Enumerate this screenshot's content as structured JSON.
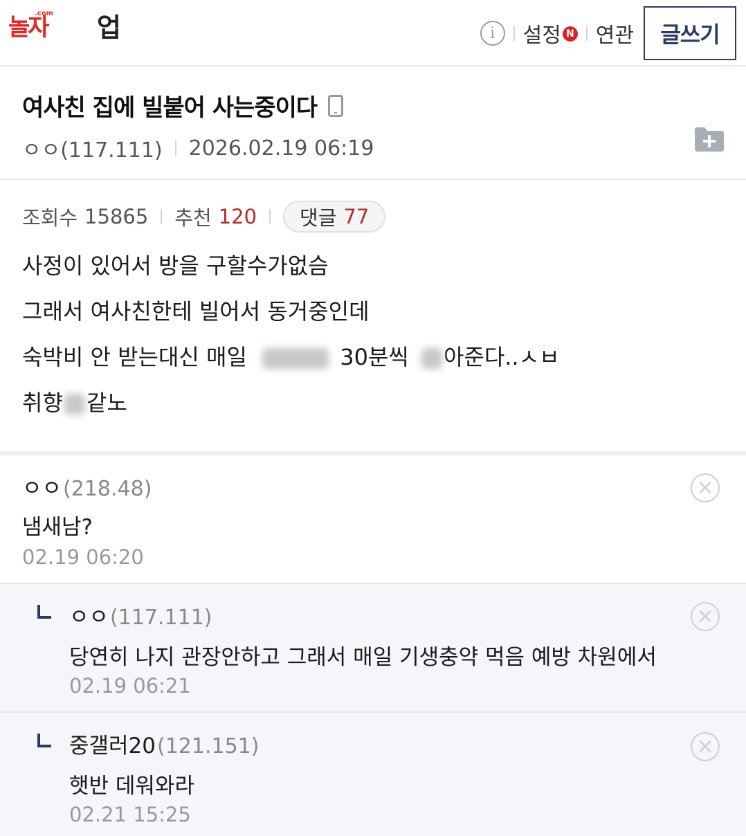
{
  "header": {
    "logo_brand": "놀자",
    "logo_brand_small": ".com",
    "logo_suffix": "업",
    "settings_label": "설정",
    "settings_badge": "N",
    "related_label": "연관",
    "write_label": "글쓰기"
  },
  "post": {
    "title": "여사친 집에 빌붙어 사는중이다",
    "author": "ㅇㅇ(117.111)",
    "datetime": "2026.02.19 06:19",
    "views_label": "조회수",
    "views": "15865",
    "recommend_label": "추천",
    "recommend": "120",
    "comments_label": "댓글",
    "comments": "77",
    "body": {
      "line1": "사정이 있어서 방을 구할수가없슴",
      "line2": "그래서 여사친한테 빌어서 동거중인데",
      "line3a": "숙박비 안 받는대신 매일",
      "line3b": "30분씩",
      "line3c": "아준다..ㅅㅂ",
      "line4a": "취향",
      "line4b": "같노"
    }
  },
  "comments": [
    {
      "nick": "ㅇㅇ",
      "ip": "(218.48)",
      "text": "냄새남?",
      "date": "02.19 06:20"
    },
    {
      "nick": "ㅇㅇ",
      "ip": "(117.111)",
      "text": "당연히 나지 관장안하고 그래서 매일 기생충약 먹음 예방 차원에서",
      "date": "02.19 06:21"
    },
    {
      "nick": "중갤러20",
      "ip": "(121.151)",
      "text": "햇반 데워와라",
      "date": "02.21 15:25"
    }
  ],
  "icons": {
    "info": "info-icon",
    "mobile": "mobile-icon",
    "folder_add": "folder-add-icon",
    "delete": "delete-icon",
    "reply": "reply-arrow-icon"
  },
  "colors": {
    "accent_navy": "#2b3a66",
    "count_red": "#b52b2b",
    "badge_red": "#d62323",
    "logo_red": "#e6251f",
    "reply_bg": "#f4f6fa"
  }
}
